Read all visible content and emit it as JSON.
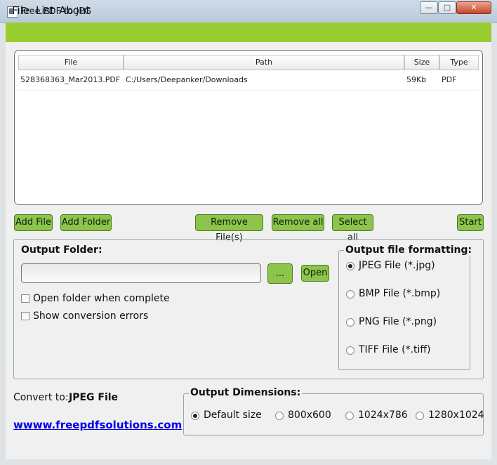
{
  "window": {
    "title": "Free PDF to JPG",
    "minimize": "—",
    "maximize": "□",
    "close": "✕"
  },
  "menu": [
    "File",
    "List",
    "About"
  ],
  "file_list": {
    "columns": [
      "File",
      "Path",
      "Size",
      "Type"
    ],
    "rows": [
      {
        "file": "528368363_Mar2013.PDF",
        "path": "C:/Users/Deepanker/Downloads",
        "size": "59Kb",
        "type": "PDF"
      }
    ]
  },
  "actions": {
    "add_file": "Add File",
    "add_folder": "Add Folder",
    "remove_files": "Remove File(s)",
    "remove_all": "Remove all",
    "select_all": "Select all",
    "start": "Start"
  },
  "output": {
    "folder_label": "Output Folder:",
    "folder_value": "",
    "browse": "...",
    "open": "Open",
    "open_when_complete": {
      "label": "Open folder when complete",
      "checked": false
    },
    "show_errors": {
      "label": "Show conversion errors",
      "checked": false
    }
  },
  "formatting": {
    "title": "Output file formatting:",
    "options": [
      {
        "label": "JPEG File (*.jpg)",
        "selected": true
      },
      {
        "label": "BMP File (*.bmp)",
        "selected": false
      },
      {
        "label": "PNG File (*.png)",
        "selected": false
      },
      {
        "label": "TIFF File (*.tiff)",
        "selected": false
      }
    ]
  },
  "convert": {
    "label": "Convert to:",
    "value": "JPEG File"
  },
  "website": "wwww.freepdfsolutions.com",
  "dimensions": {
    "title": "Output Dimensions:",
    "options": [
      {
        "label": "Default size",
        "selected": true
      },
      {
        "label": "800x600",
        "selected": false
      },
      {
        "label": "1024x786",
        "selected": false
      },
      {
        "label": "1280x1024",
        "selected": false
      }
    ]
  }
}
